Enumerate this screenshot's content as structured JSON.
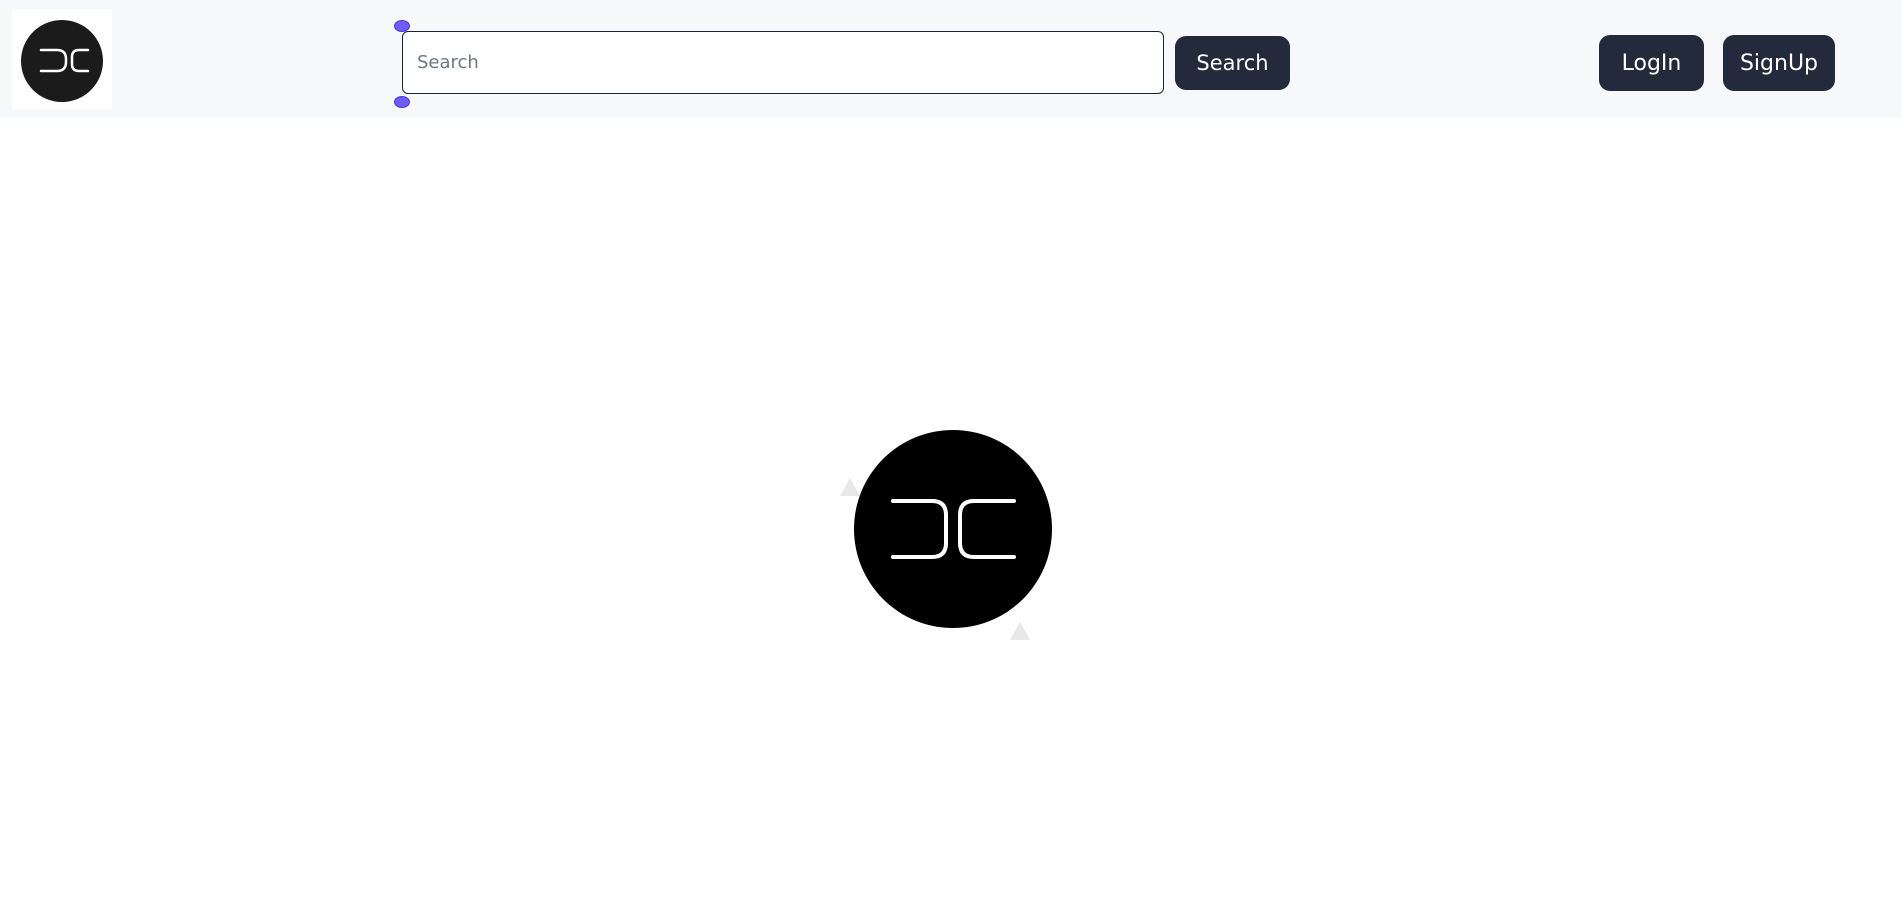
{
  "header": {
    "logo": {
      "icon": "dc-monogram-logo-icon"
    },
    "search": {
      "placeholder": "Search",
      "value": ""
    },
    "search_button_label": "Search",
    "login_label": "LogIn",
    "signup_label": "SignUp"
  },
  "main": {
    "hero_logo": {
      "icon": "dc-monogram-logo-icon"
    }
  },
  "colors": {
    "header_bg": "#f7f8fa",
    "button_bg": "#232a3b",
    "button_text": "#ffffff",
    "logo_bg": "#000000",
    "selection_handle": "#6d5df5"
  }
}
